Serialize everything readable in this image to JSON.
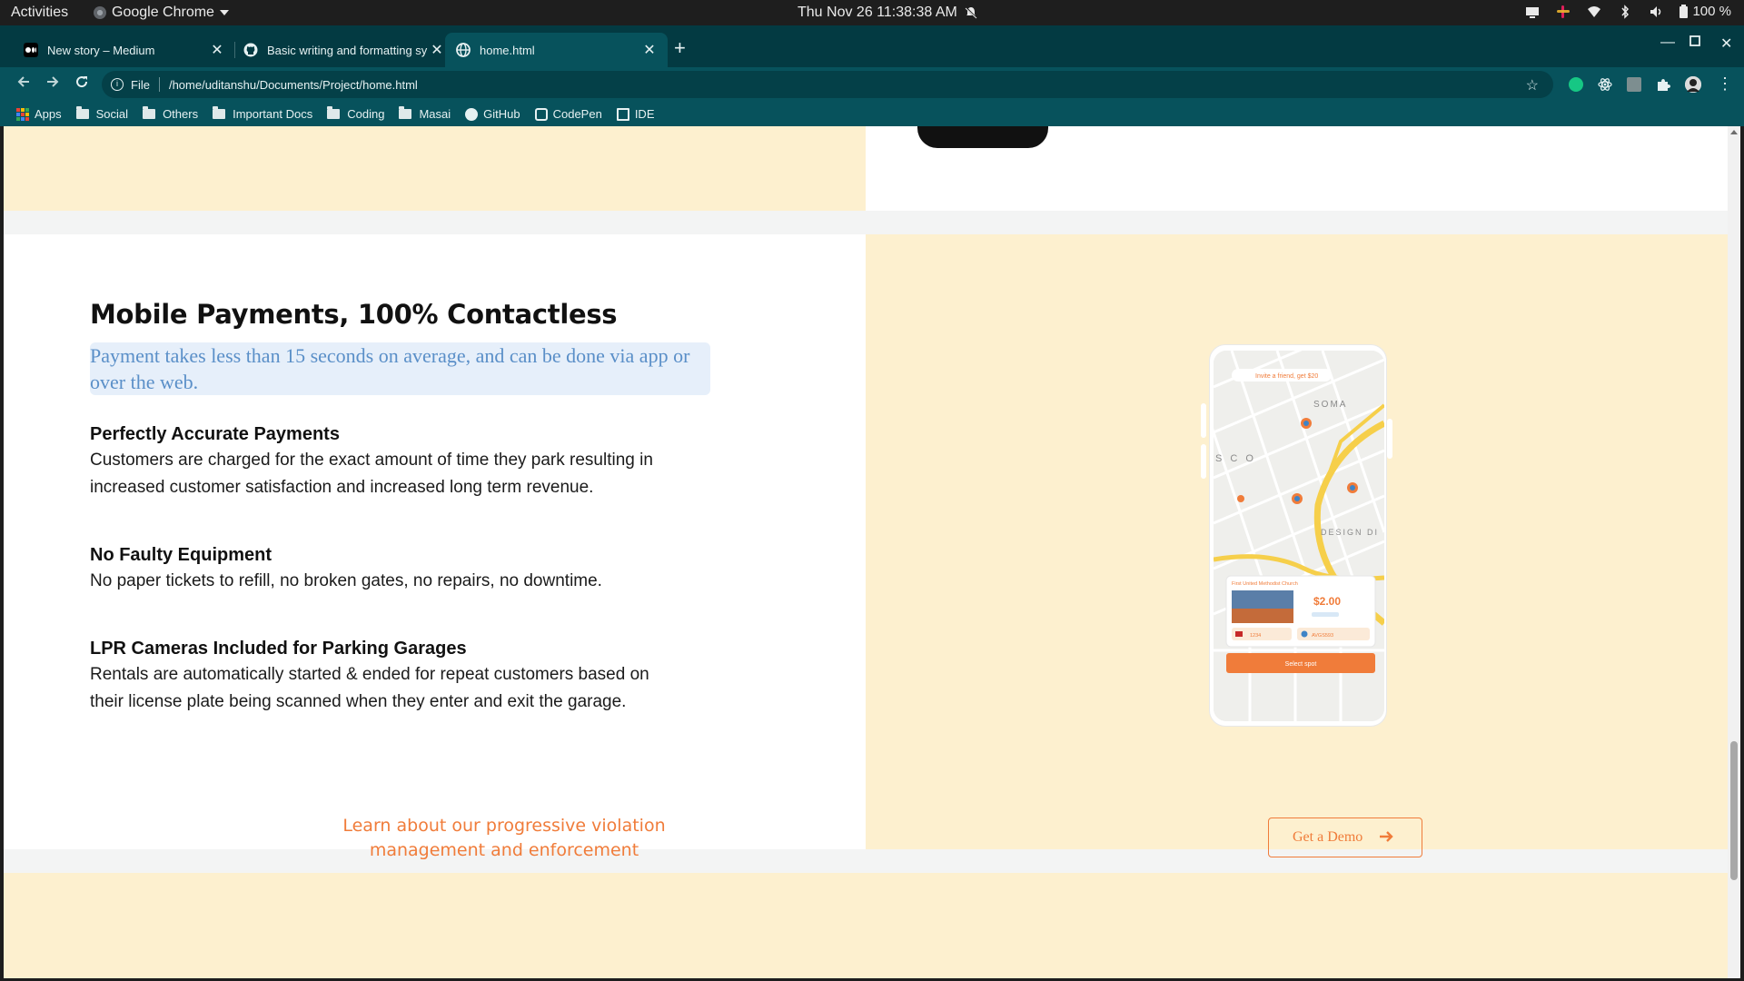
{
  "os": {
    "activities": "Activities",
    "app_name": "Google Chrome",
    "clock": "Thu Nov 26  11:38:38 AM",
    "battery": "100 %"
  },
  "browser": {
    "tabs": [
      {
        "title": "New story – Medium",
        "active": false
      },
      {
        "title": "Basic writing and formatting sy",
        "active": false
      },
      {
        "title": "home.html",
        "active": true
      }
    ],
    "address_scheme": "File",
    "address_url": "/home/uditanshu/Documents/Project/home.html",
    "bookmarks": [
      {
        "label": "Apps",
        "icon": "apps-grid-icon"
      },
      {
        "label": "Social",
        "icon": "folder-icon"
      },
      {
        "label": "Others",
        "icon": "folder-icon"
      },
      {
        "label": "Important Docs",
        "icon": "folder-icon"
      },
      {
        "label": "Coding",
        "icon": "folder-icon"
      },
      {
        "label": "Masai",
        "icon": "folder-icon"
      },
      {
        "label": "GitHub",
        "icon": "github-icon"
      },
      {
        "label": "CodePen",
        "icon": "codepen-icon"
      },
      {
        "label": "IDE",
        "icon": "ide-icon"
      }
    ]
  },
  "page": {
    "heading": "Mobile Payments, 100% Contactless",
    "subtitle": "Payment takes less than 15 seconds on average, and can be done via app or over the web.",
    "features": [
      {
        "title": "Perfectly Accurate Payments",
        "text": "Customers are charged for the exact amount of time they park resulting in increased customer satisfaction and increased long term revenue."
      },
      {
        "title": "No Faulty Equipment",
        "text": "No paper tickets to refill, no broken gates, no repairs, no downtime."
      },
      {
        "title": "LPR Cameras Included for Parking Garages",
        "text": "Rentals are automatically started & ended for repeat customers based on their license plate being scanned when they enter and exit the garage."
      }
    ],
    "phone": {
      "invite": "Invite a friend, get $20",
      "map_labels": [
        "SOMA",
        "S C O",
        "DESIGN DI"
      ],
      "card_title": "First United Methodist Church",
      "price": "$2.00",
      "plate": "1234",
      "vehicle": "AVGS593",
      "select_button": "Select spot"
    },
    "learn_text": "Learn about our progressive violation management and enforcement",
    "demo_button": "Get a Demo",
    "accent_color": "#f07c3a",
    "cream_color": "#fdf0cf"
  }
}
